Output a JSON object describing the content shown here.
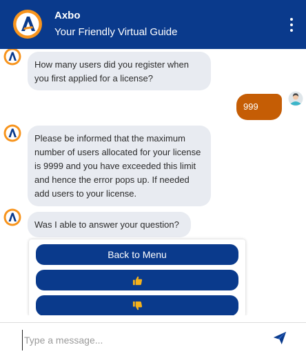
{
  "header": {
    "title": "Axbo",
    "subtitle": "Your Friendly Virtual Guide"
  },
  "messages": [
    {
      "from": "bot",
      "text": "How many users did you register when you first applied for a license?"
    },
    {
      "from": "user",
      "text": "999"
    },
    {
      "from": "bot",
      "text": "Please be informed that the maximum number of users allocated for your license is 9999 and you have exceeded this limit and hence the error pops up. If needed add users to your license."
    },
    {
      "from": "bot",
      "text": "Was I able to answer your question?"
    }
  ],
  "quick_replies": {
    "back_label": "Back to Menu",
    "thumbs_up_icon": "thumbs-up-icon",
    "thumbs_down_icon": "thumbs-down-icon"
  },
  "composer": {
    "placeholder": "Type a message..."
  },
  "colors": {
    "brand": "#0a3a8c",
    "accent": "#f7941d",
    "user_bubble": "#c55d05",
    "bot_bubble": "#e8ebf1",
    "thumb": "#f6b21b"
  }
}
